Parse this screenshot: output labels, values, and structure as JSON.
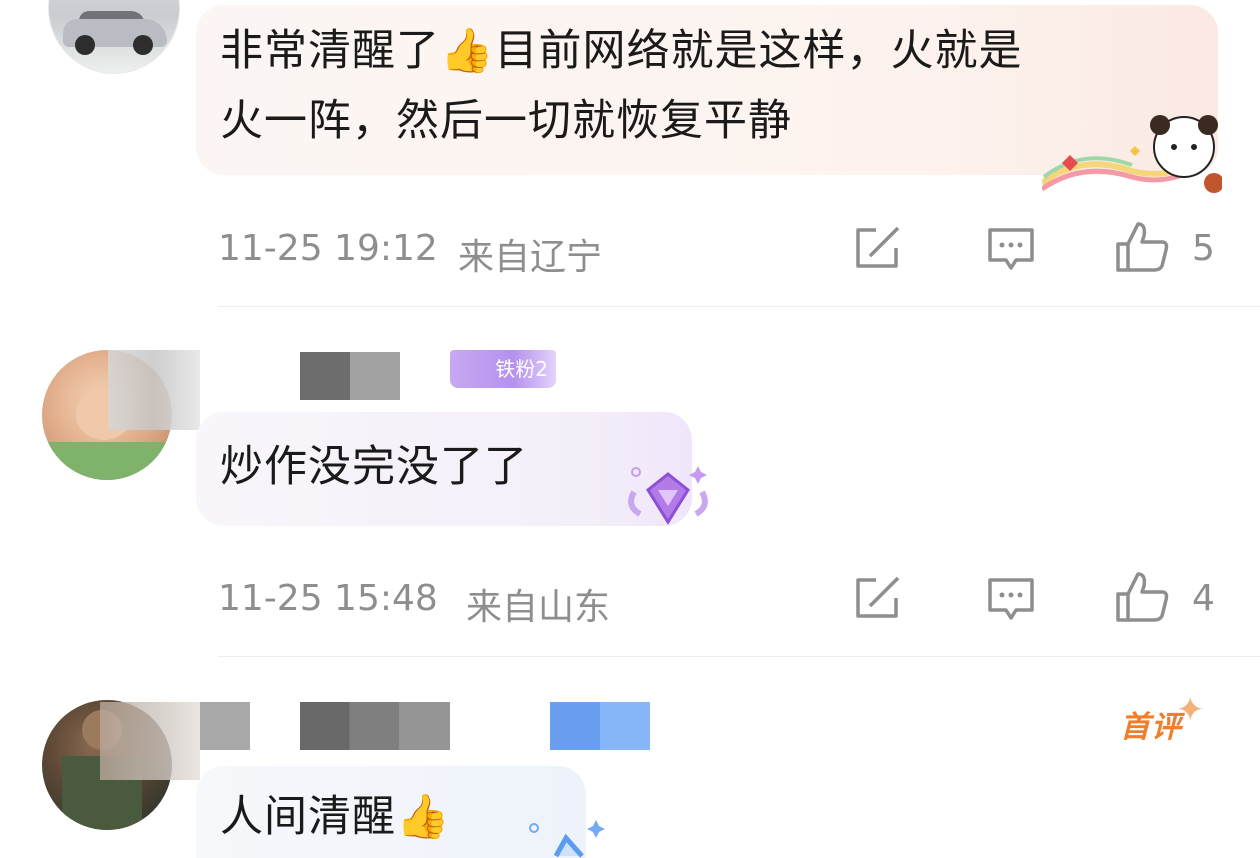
{
  "comments": [
    {
      "text_line1": "非常清醒了👍目前网络就是这样，火就是",
      "text_line2": "火一阵，然后一切就恢复平静",
      "time": "11-25 19:12",
      "location": "来自辽宁",
      "likes": "5"
    },
    {
      "badge_text": "铁粉2",
      "text_line1": "炒作没完没了了",
      "time": "11-25 15:48",
      "location": "来自山东",
      "likes": "4"
    },
    {
      "first_badge": "首评",
      "text_line1": "人间清醒👍"
    }
  ],
  "icons": {
    "share": "edit-square-icon",
    "comment": "comment-bubble-icon",
    "like": "thumbs-up-icon"
  },
  "colors": {
    "meta_gray": "#8e8e8e",
    "first_comment_orange": "#f07e2a",
    "fan_badge_purple": "#b591ee"
  }
}
